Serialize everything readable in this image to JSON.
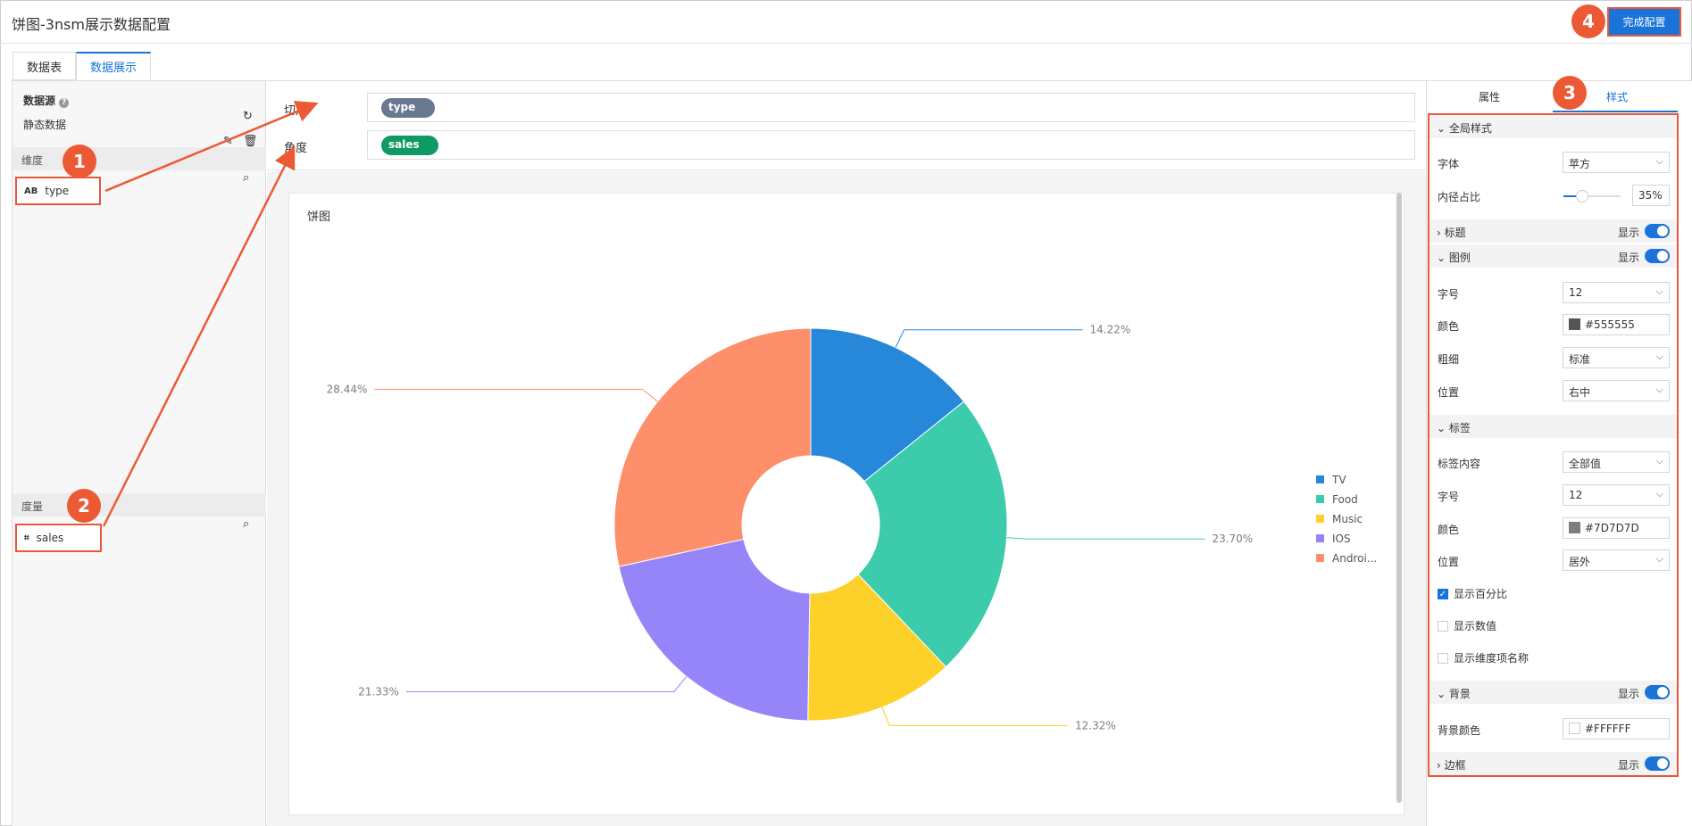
{
  "header": {
    "title": "饼图-3nsm展示数据配置",
    "done_label": "完成配置"
  },
  "tabs": [
    {
      "label": "数据表"
    },
    {
      "label": "数据展示"
    }
  ],
  "left_panel": {
    "datasource_label": "数据源",
    "datasource_value": "静态数据",
    "dimension_section": "维度",
    "dimension_field": {
      "type_icon": "AB",
      "name": "type"
    },
    "measure_section": "度量",
    "measure_field": {
      "type_icon": "⌗",
      "name": "sales"
    }
  },
  "slots": {
    "slice_label": "切片",
    "slice_value": "type",
    "angle_label": "角度",
    "angle_value": "sales"
  },
  "annotations": [
    "1",
    "2",
    "3",
    "4"
  ],
  "chart_data": {
    "type": "pie",
    "title": "饼图",
    "inner_radius_ratio": 0.35,
    "categories": [
      "TV",
      "Food",
      "Music",
      "IOS",
      "Android"
    ],
    "legend_labels": [
      "TV",
      "Food",
      "Music",
      "IOS",
      "Androi..."
    ],
    "values": [
      14.22,
      23.7,
      12.32,
      21.33,
      28.44
    ],
    "labels": [
      "14.22%",
      "23.70%",
      "12.32%",
      "21.33%",
      "28.44%"
    ],
    "colors": [
      "#2787d9",
      "#3ccbab",
      "#fdd12a",
      "#9585f8",
      "#fe8f6b"
    ],
    "legend_position": "right-middle"
  },
  "right_panel": {
    "tab_props": "属性",
    "tab_style": "样式",
    "global_style": "全局样式",
    "font_label": "字体",
    "font_value": "苹方",
    "inner_ratio_label": "内径占比",
    "inner_ratio_value": "35%",
    "title_section": "标题",
    "show_label": "显示",
    "legend_section": "图例",
    "legend_size_label": "字号",
    "legend_size_value": "12",
    "legend_color_label": "颜色",
    "legend_color_value": "#555555",
    "legend_weight_label": "粗细",
    "legend_weight_value": "标准",
    "legend_pos_label": "位置",
    "legend_pos_value": "右中",
    "label_section": "标签",
    "label_content_label": "标签内容",
    "label_content_value": "全部值",
    "label_size_label": "字号",
    "label_size_value": "12",
    "label_color_label": "颜色",
    "label_color_value": "#7D7D7D",
    "label_pos_label": "位置",
    "label_pos_value": "居外",
    "show_percent": "显示百分比",
    "show_value": "显示数值",
    "show_dim_name": "显示维度项名称",
    "bg_section": "背景",
    "bg_color_label": "背景颜色",
    "bg_color_value": "#FFFFFF",
    "border_section": "边框"
  }
}
